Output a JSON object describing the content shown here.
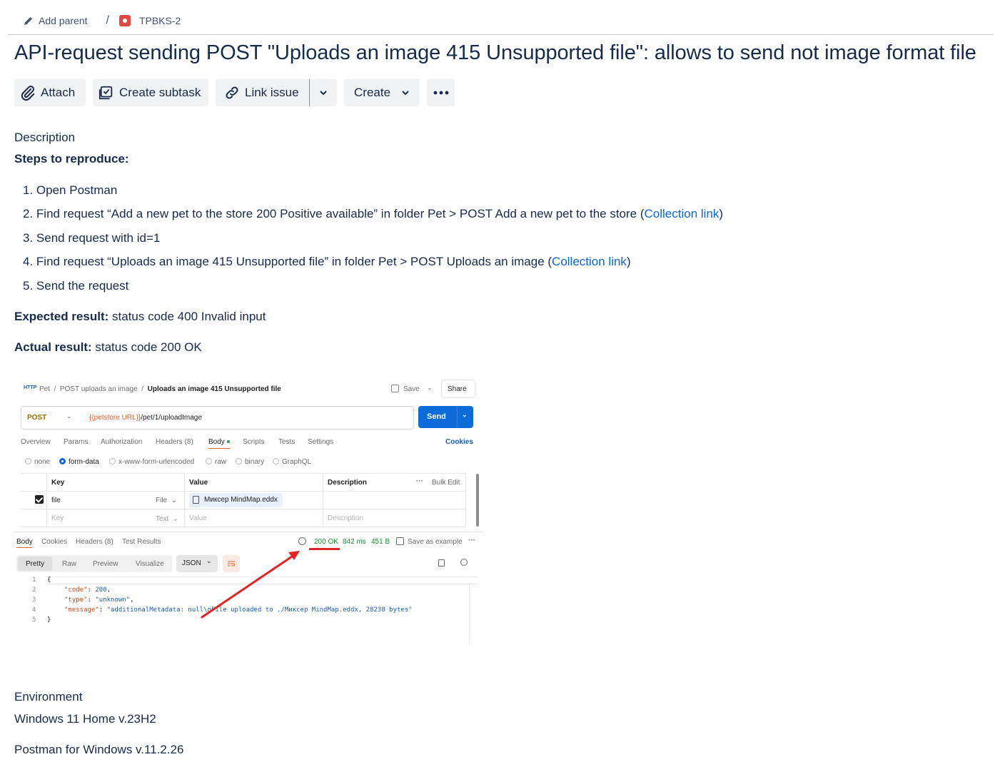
{
  "breadcrumb": {
    "add_parent": "Add parent",
    "separator": "/",
    "issue_key": "TPBKS-2"
  },
  "title": "API-request sending POST \"Uploads an image 415 Unsupported file\": allows to send not image format file",
  "toolbar": {
    "attach": "Attach",
    "create_subtask": "Create subtask",
    "link_issue": "Link issue",
    "create": "Create"
  },
  "description": {
    "heading": "Description",
    "steps_heading": "Steps to reproduce:",
    "steps": [
      {
        "num": "1.",
        "text": "Open Postman"
      },
      {
        "num": "2.",
        "text": "Find request “Add a new pet to the store 200 Positive available” in folder Pet > POST Add a new pet to the store (",
        "link": "Collection link",
        "after": ")"
      },
      {
        "num": "3.",
        "text": "Send request with id=1"
      },
      {
        "num": "4.",
        "text": "Find request “Uploads an image 415 Unsupported file” in folder Pet > POST Uploads an image (",
        "link": "Collection link",
        "after": ")"
      },
      {
        "num": "5.",
        "text": "Send the request"
      }
    ],
    "expected_label": "Expected result:",
    "expected_value": " status code 400 Invalid input",
    "actual_label": "Actual result:",
    "actual_value": " status code 200 OK"
  },
  "screenshot": {
    "http_badge": "HTTP",
    "crumb_pet": "Pet",
    "crumb_sep": "/",
    "crumb_folder": "POST uploads an image",
    "crumb_request": "Uploads an image 415 Unsupported file",
    "save": "Save",
    "share": "Share",
    "method": "POST",
    "url_var": "{{petstore URL}}",
    "url_path": "/pet/1/uploadImage",
    "send": "Send",
    "request_tabs": [
      "Overview",
      "Params",
      "Authorization",
      "Headers (8)",
      "Body",
      "Scripts",
      "Tests",
      "Settings"
    ],
    "cookies": "Cookies",
    "body_modes": [
      "none",
      "form-data",
      "x-www-form-urlencoded",
      "raw",
      "binary",
      "GraphQL"
    ],
    "table_headers": {
      "key": "Key",
      "value": "Value",
      "description": "Description",
      "bulk_edit": "Bulk Edit"
    },
    "row1": {
      "key": "file",
      "type": "File",
      "value": "Миксер MindMap.eddx"
    },
    "row2": {
      "key": "Key",
      "type": "Text",
      "value": "Value",
      "description": "Description"
    },
    "response_tabs": [
      "Body",
      "Cookies",
      "Headers (8)",
      "Test Results"
    ],
    "status": "200 OK",
    "time": "842 ms",
    "size": "451 B",
    "save_example": "Save as example",
    "view_modes": [
      "Pretty",
      "Raw",
      "Preview",
      "Visualize"
    ],
    "format": "JSON",
    "lines": [
      "1",
      "2",
      "3",
      "4",
      "5"
    ],
    "json": {
      "open": "{",
      "code_key": "\"code\"",
      "code_val": "200",
      "type_key": "\"type\"",
      "type_val": "\"unknown\"",
      "message_key": "\"message\"",
      "message_val": "\"additionalMetadata: null\\nFile uploaded to ./Миксер MindMap.eddx, 28238 bytes\"",
      "close": "}"
    },
    "annotation_color": "#e02424"
  },
  "environment": {
    "heading": "Environment",
    "os": "Windows 11 Home v.23H2",
    "app": "Postman for Windows v.11.2.26"
  },
  "colors": {
    "link": "#0c66e4",
    "text": "#172b4d",
    "button_bg": "#f1f2f4",
    "bug_icon": "#e2483d"
  }
}
